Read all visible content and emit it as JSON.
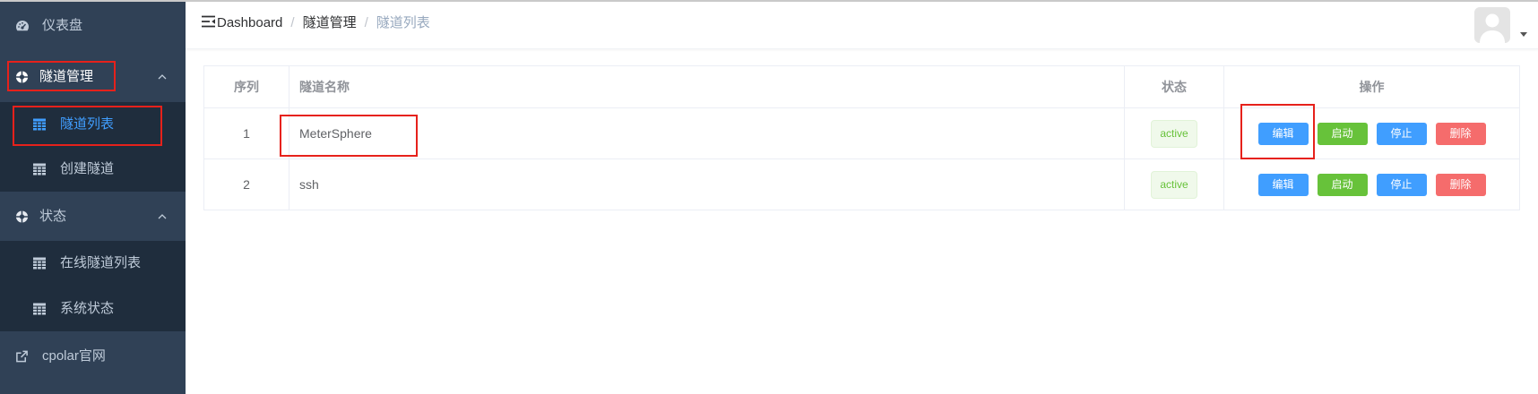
{
  "theme": {
    "sidebar_bg": "#304156",
    "submenu_bg": "#1f2d3d",
    "sidebar_text": "#bfcbd9",
    "active_text": "#409eff",
    "primary": "#409eff",
    "success": "#67c23a",
    "danger": "#f56c6c",
    "annotation": "#e6211b"
  },
  "sidebar": {
    "items": [
      {
        "label": "仪表盘",
        "icon": "dashboard-icon"
      },
      {
        "label": "隧道管理",
        "icon": "lifebuoy-icon",
        "expanded": true,
        "children": [
          {
            "label": "隧道列表",
            "icon": "table-icon",
            "active": true
          },
          {
            "label": "创建隧道",
            "icon": "table-icon"
          }
        ]
      },
      {
        "label": "状态",
        "icon": "lifebuoy-icon",
        "expanded": true,
        "children": [
          {
            "label": "在线隧道列表",
            "icon": "table-icon"
          },
          {
            "label": "系统状态",
            "icon": "table-icon"
          }
        ]
      },
      {
        "label": "cpolar官网",
        "icon": "external-link-icon"
      }
    ]
  },
  "header": {
    "toggle_icon": "hamburger-icon",
    "breadcrumb": [
      "Dashboard",
      "隧道管理",
      "隧道列表"
    ],
    "separator": "/",
    "avatar_icon": "avatar-icon"
  },
  "table": {
    "columns": [
      "序列",
      "隧道名称",
      "状态",
      "操作"
    ],
    "rows": [
      {
        "index": "1",
        "name": "MeterSphere",
        "status": "active"
      },
      {
        "index": "2",
        "name": "ssh",
        "status": "active"
      }
    ],
    "actions": [
      "编辑",
      "启动",
      "停止",
      "删除"
    ]
  }
}
